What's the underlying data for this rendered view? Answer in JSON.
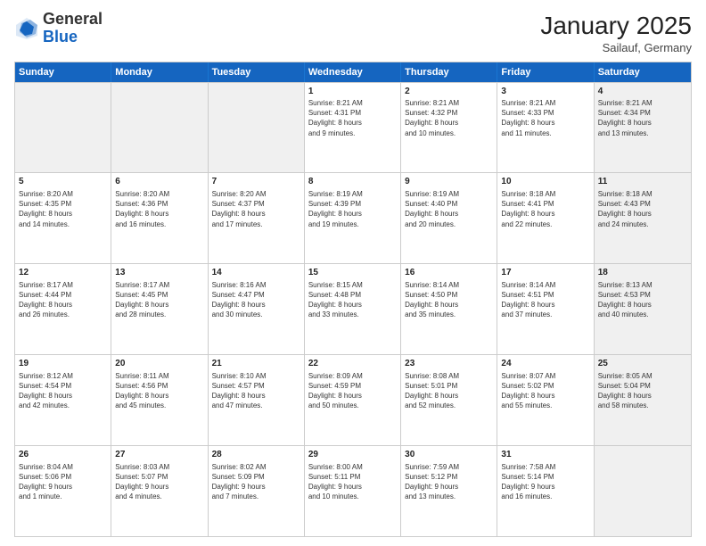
{
  "header": {
    "logo_general": "General",
    "logo_blue": "Blue",
    "month_title": "January 2025",
    "location": "Sailauf, Germany"
  },
  "days_of_week": [
    "Sunday",
    "Monday",
    "Tuesday",
    "Wednesday",
    "Thursday",
    "Friday",
    "Saturday"
  ],
  "weeks": [
    [
      {
        "day": "",
        "info": "",
        "shaded": true
      },
      {
        "day": "",
        "info": "",
        "shaded": true
      },
      {
        "day": "",
        "info": "",
        "shaded": true
      },
      {
        "day": "1",
        "info": "Sunrise: 8:21 AM\nSunset: 4:31 PM\nDaylight: 8 hours\nand 9 minutes.",
        "shaded": false
      },
      {
        "day": "2",
        "info": "Sunrise: 8:21 AM\nSunset: 4:32 PM\nDaylight: 8 hours\nand 10 minutes.",
        "shaded": false
      },
      {
        "day": "3",
        "info": "Sunrise: 8:21 AM\nSunset: 4:33 PM\nDaylight: 8 hours\nand 11 minutes.",
        "shaded": false
      },
      {
        "day": "4",
        "info": "Sunrise: 8:21 AM\nSunset: 4:34 PM\nDaylight: 8 hours\nand 13 minutes.",
        "shaded": true
      }
    ],
    [
      {
        "day": "5",
        "info": "Sunrise: 8:20 AM\nSunset: 4:35 PM\nDaylight: 8 hours\nand 14 minutes.",
        "shaded": false
      },
      {
        "day": "6",
        "info": "Sunrise: 8:20 AM\nSunset: 4:36 PM\nDaylight: 8 hours\nand 16 minutes.",
        "shaded": false
      },
      {
        "day": "7",
        "info": "Sunrise: 8:20 AM\nSunset: 4:37 PM\nDaylight: 8 hours\nand 17 minutes.",
        "shaded": false
      },
      {
        "day": "8",
        "info": "Sunrise: 8:19 AM\nSunset: 4:39 PM\nDaylight: 8 hours\nand 19 minutes.",
        "shaded": false
      },
      {
        "day": "9",
        "info": "Sunrise: 8:19 AM\nSunset: 4:40 PM\nDaylight: 8 hours\nand 20 minutes.",
        "shaded": false
      },
      {
        "day": "10",
        "info": "Sunrise: 8:18 AM\nSunset: 4:41 PM\nDaylight: 8 hours\nand 22 minutes.",
        "shaded": false
      },
      {
        "day": "11",
        "info": "Sunrise: 8:18 AM\nSunset: 4:43 PM\nDaylight: 8 hours\nand 24 minutes.",
        "shaded": true
      }
    ],
    [
      {
        "day": "12",
        "info": "Sunrise: 8:17 AM\nSunset: 4:44 PM\nDaylight: 8 hours\nand 26 minutes.",
        "shaded": false
      },
      {
        "day": "13",
        "info": "Sunrise: 8:17 AM\nSunset: 4:45 PM\nDaylight: 8 hours\nand 28 minutes.",
        "shaded": false
      },
      {
        "day": "14",
        "info": "Sunrise: 8:16 AM\nSunset: 4:47 PM\nDaylight: 8 hours\nand 30 minutes.",
        "shaded": false
      },
      {
        "day": "15",
        "info": "Sunrise: 8:15 AM\nSunset: 4:48 PM\nDaylight: 8 hours\nand 33 minutes.",
        "shaded": false
      },
      {
        "day": "16",
        "info": "Sunrise: 8:14 AM\nSunset: 4:50 PM\nDaylight: 8 hours\nand 35 minutes.",
        "shaded": false
      },
      {
        "day": "17",
        "info": "Sunrise: 8:14 AM\nSunset: 4:51 PM\nDaylight: 8 hours\nand 37 minutes.",
        "shaded": false
      },
      {
        "day": "18",
        "info": "Sunrise: 8:13 AM\nSunset: 4:53 PM\nDaylight: 8 hours\nand 40 minutes.",
        "shaded": true
      }
    ],
    [
      {
        "day": "19",
        "info": "Sunrise: 8:12 AM\nSunset: 4:54 PM\nDaylight: 8 hours\nand 42 minutes.",
        "shaded": false
      },
      {
        "day": "20",
        "info": "Sunrise: 8:11 AM\nSunset: 4:56 PM\nDaylight: 8 hours\nand 45 minutes.",
        "shaded": false
      },
      {
        "day": "21",
        "info": "Sunrise: 8:10 AM\nSunset: 4:57 PM\nDaylight: 8 hours\nand 47 minutes.",
        "shaded": false
      },
      {
        "day": "22",
        "info": "Sunrise: 8:09 AM\nSunset: 4:59 PM\nDaylight: 8 hours\nand 50 minutes.",
        "shaded": false
      },
      {
        "day": "23",
        "info": "Sunrise: 8:08 AM\nSunset: 5:01 PM\nDaylight: 8 hours\nand 52 minutes.",
        "shaded": false
      },
      {
        "day": "24",
        "info": "Sunrise: 8:07 AM\nSunset: 5:02 PM\nDaylight: 8 hours\nand 55 minutes.",
        "shaded": false
      },
      {
        "day": "25",
        "info": "Sunrise: 8:05 AM\nSunset: 5:04 PM\nDaylight: 8 hours\nand 58 minutes.",
        "shaded": true
      }
    ],
    [
      {
        "day": "26",
        "info": "Sunrise: 8:04 AM\nSunset: 5:06 PM\nDaylight: 9 hours\nand 1 minute.",
        "shaded": false
      },
      {
        "day": "27",
        "info": "Sunrise: 8:03 AM\nSunset: 5:07 PM\nDaylight: 9 hours\nand 4 minutes.",
        "shaded": false
      },
      {
        "day": "28",
        "info": "Sunrise: 8:02 AM\nSunset: 5:09 PM\nDaylight: 9 hours\nand 7 minutes.",
        "shaded": false
      },
      {
        "day": "29",
        "info": "Sunrise: 8:00 AM\nSunset: 5:11 PM\nDaylight: 9 hours\nand 10 minutes.",
        "shaded": false
      },
      {
        "day": "30",
        "info": "Sunrise: 7:59 AM\nSunset: 5:12 PM\nDaylight: 9 hours\nand 13 minutes.",
        "shaded": false
      },
      {
        "day": "31",
        "info": "Sunrise: 7:58 AM\nSunset: 5:14 PM\nDaylight: 9 hours\nand 16 minutes.",
        "shaded": false
      },
      {
        "day": "",
        "info": "",
        "shaded": true
      }
    ]
  ]
}
